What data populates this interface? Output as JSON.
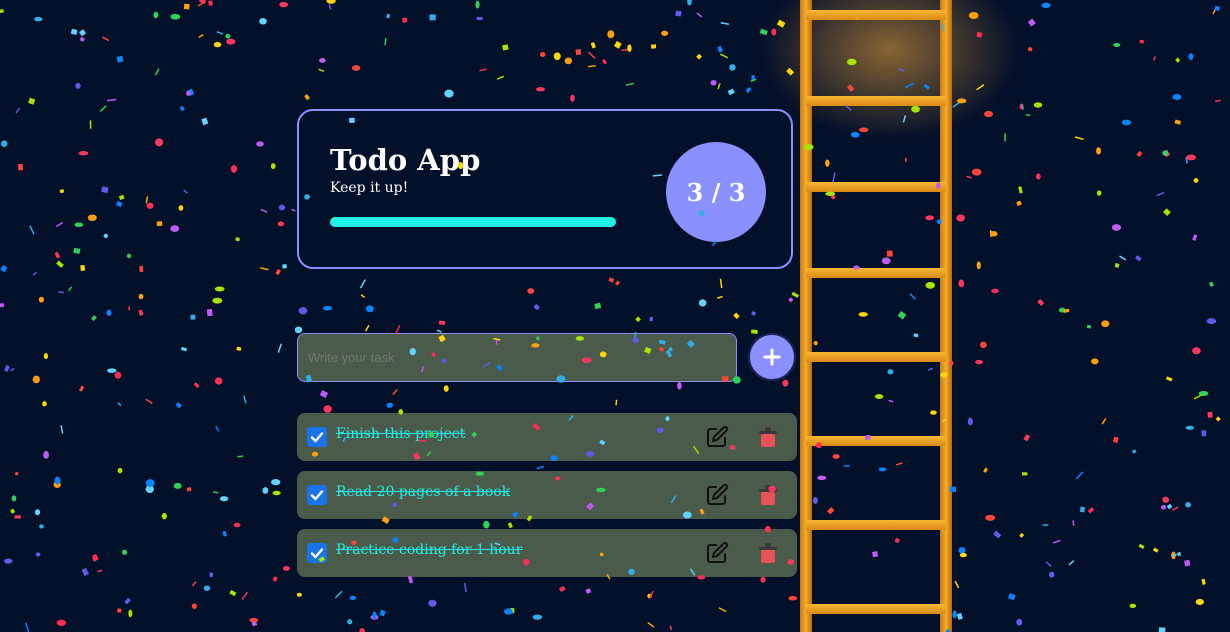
{
  "header": {
    "title": "Todo App",
    "subtitle": "Keep it up!",
    "progress_fraction": 1.0,
    "counter": "3 / 3"
  },
  "input": {
    "placeholder": "Write your task",
    "value": ""
  },
  "add_button": {
    "icon": "plus-icon"
  },
  "tasks": [
    {
      "text": "Finish this project",
      "completed": true
    },
    {
      "text": "Read 20 pages of a book",
      "completed": true
    },
    {
      "text": "Practice coding for 1 hour",
      "completed": true
    }
  ],
  "icons": {
    "edit": "edit-icon",
    "delete": "trash-icon",
    "check": "checkmark-icon"
  },
  "colors": {
    "background": "#031029",
    "accent": "#8b90ff",
    "progress": "#22f2e6",
    "task_background": "#4a5a4b",
    "completed_text": "#22f2e6",
    "delete": "#e8535a",
    "ladder": "#f5ad2a"
  },
  "decor": {
    "confetti": true,
    "ladder": true
  }
}
